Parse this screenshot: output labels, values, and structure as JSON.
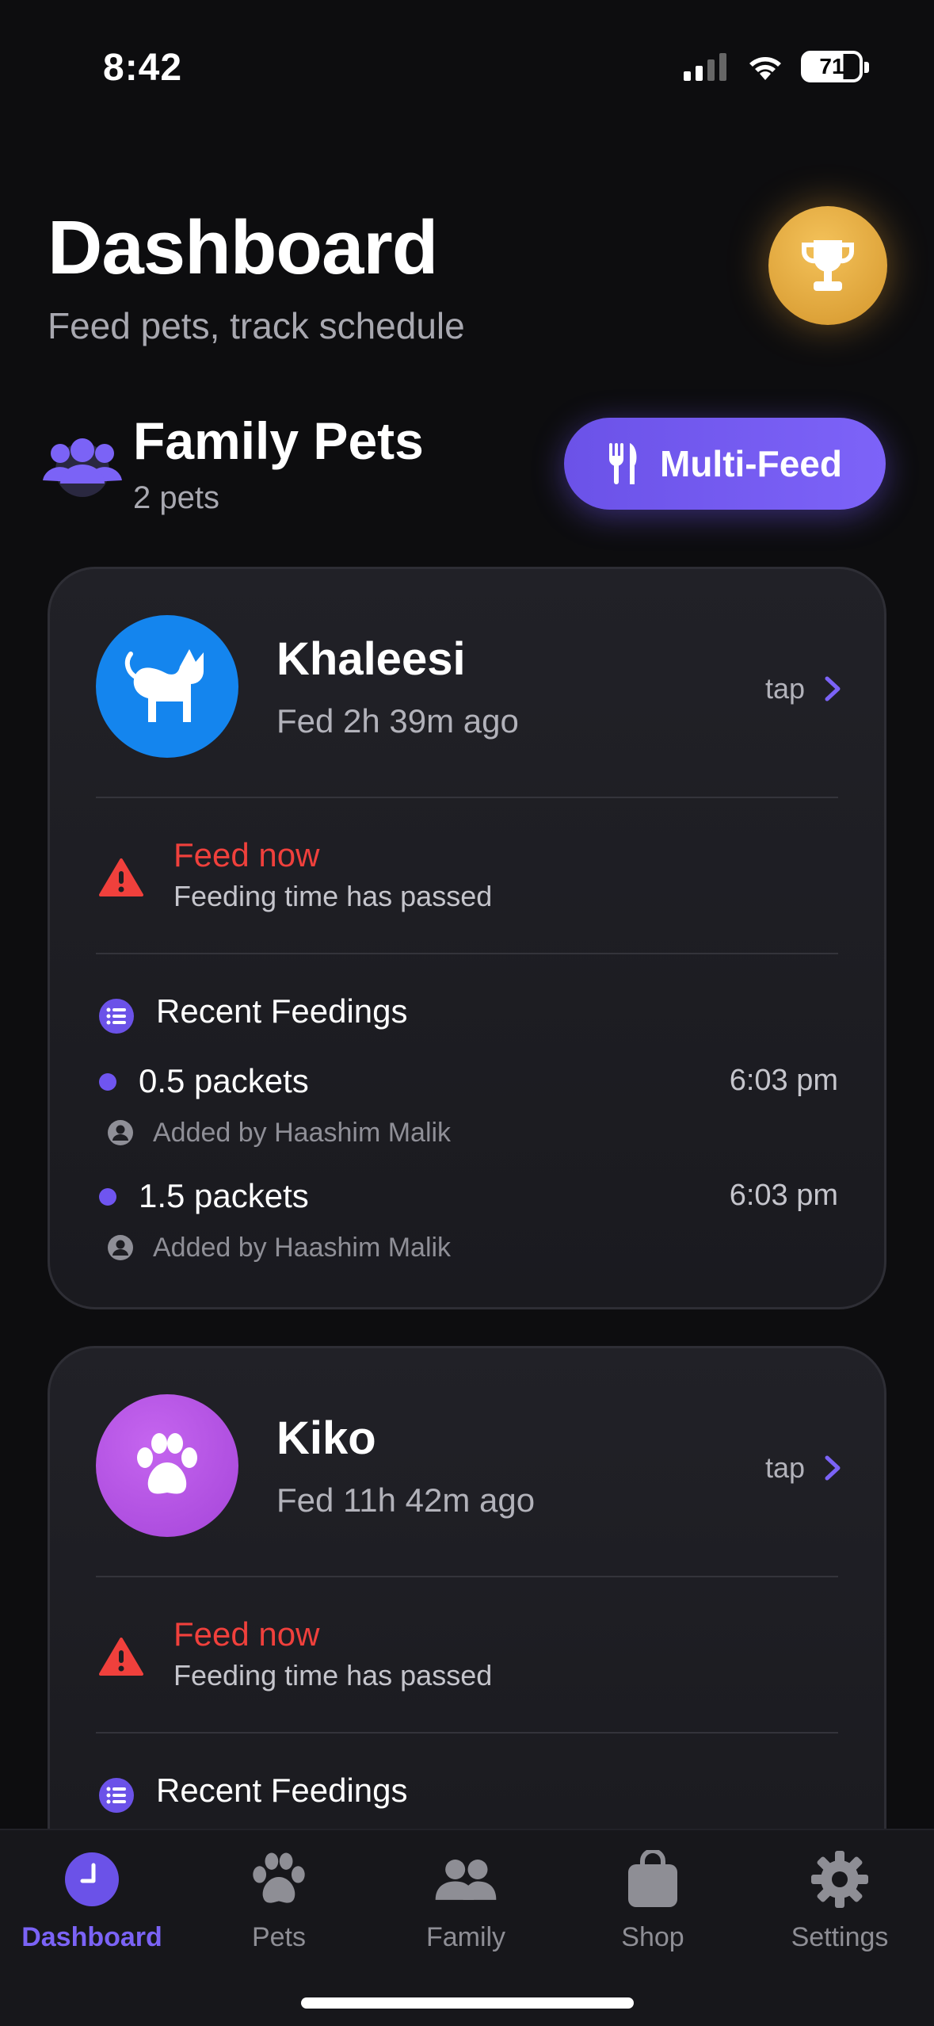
{
  "status_bar": {
    "time": "8:42",
    "battery": "71"
  },
  "header": {
    "title": "Dashboard",
    "subtitle": "Feed pets, track schedule"
  },
  "family": {
    "title": "Family Pets",
    "count": "2 pets",
    "multifeed_label": "Multi-Feed"
  },
  "pets": [
    {
      "name": "Khaleesi",
      "fed": "Fed 2h 39m ago",
      "tap": "tap",
      "avatar_color": "#1485ee",
      "warning_title": "Feed now",
      "warning_sub": "Feeding time has passed",
      "recent_title": "Recent Feedings",
      "feedings": [
        {
          "amount": "0.5 packets",
          "time": "6:03 pm",
          "added_by": "Added by Haashim Malik"
        },
        {
          "amount": "1.5 packets",
          "time": "6:03 pm",
          "added_by": "Added by Haashim Malik"
        }
      ]
    },
    {
      "name": "Kiko",
      "fed": "Fed 11h 42m ago",
      "tap": "tap",
      "avatar_color": "#b04fe0",
      "warning_title": "Feed now",
      "warning_sub": "Feeding time has passed",
      "recent_title": "Recent Feedings"
    }
  ],
  "tabs": [
    {
      "label": "Dashboard",
      "icon": "clock-icon",
      "active": true
    },
    {
      "label": "Pets",
      "icon": "paw-icon",
      "active": false
    },
    {
      "label": "Family",
      "icon": "people-icon",
      "active": false
    },
    {
      "label": "Shop",
      "icon": "bag-icon",
      "active": false
    },
    {
      "label": "Settings",
      "icon": "gear-icon",
      "active": false
    }
  ],
  "colors": {
    "accent": "#6b52e8",
    "warning": "#f0403c",
    "gold": "#e6aa3c",
    "background": "#0d0d0f"
  }
}
